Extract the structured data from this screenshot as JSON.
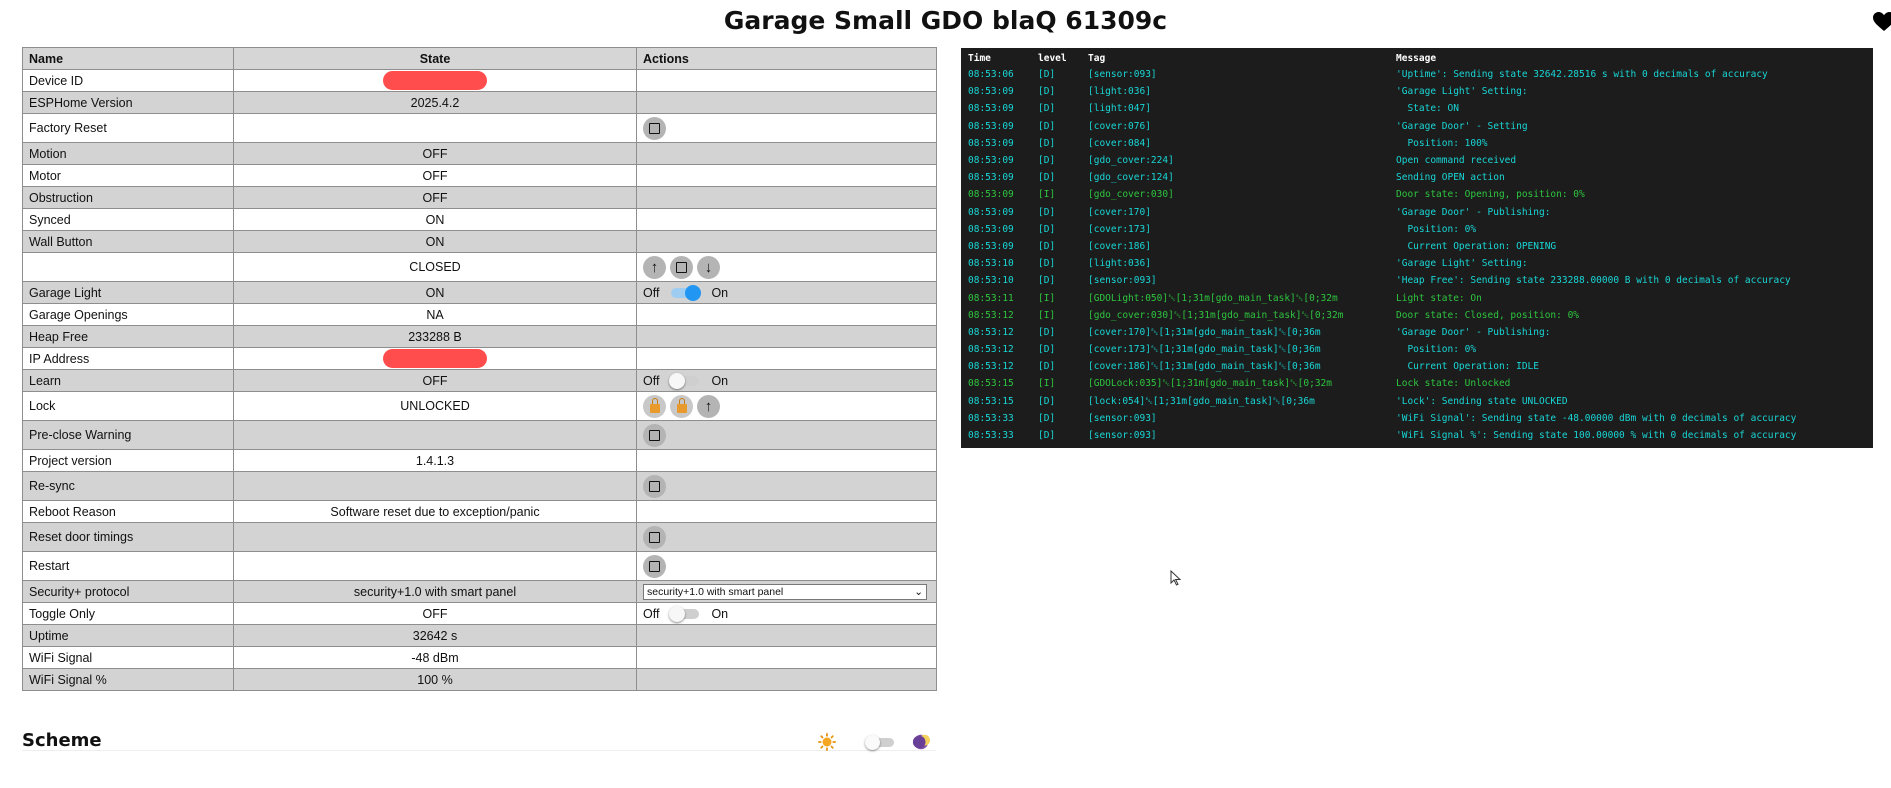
{
  "page": {
    "title": "Garage Small GDO blaQ 61309c",
    "heart_icon": "heart-icon"
  },
  "table": {
    "headers": {
      "name": "Name",
      "state": "State",
      "actions": "Actions"
    },
    "rows": [
      {
        "name": "Device ID",
        "state": "",
        "redacted": true
      },
      {
        "name": "ESPHome Version",
        "state": "2025.4.2"
      },
      {
        "name": "Factory Reset",
        "state": ""
      },
      {
        "name": "Motion",
        "state": "OFF"
      },
      {
        "name": "Motor",
        "state": "OFF"
      },
      {
        "name": "Obstruction",
        "state": "OFF"
      },
      {
        "name": "Synced",
        "state": "ON"
      },
      {
        "name": "Wall Button",
        "state": "ON"
      },
      {
        "name": "",
        "state": "CLOSED"
      },
      {
        "name": "Garage Light",
        "state": "ON",
        "toggle": {
          "off": "Off",
          "on": "On",
          "checked": true
        }
      },
      {
        "name": "Garage Openings",
        "state": "NA"
      },
      {
        "name": "Heap Free",
        "state": "233288 B"
      },
      {
        "name": "IP Address",
        "state": "",
        "redacted": true
      },
      {
        "name": "Learn",
        "state": "OFF",
        "toggle": {
          "off": "Off",
          "on": "On",
          "checked": false
        }
      },
      {
        "name": "Lock",
        "state": "UNLOCKED"
      },
      {
        "name": "Pre-close Warning",
        "state": ""
      },
      {
        "name": "Project version",
        "state": "1.4.1.3"
      },
      {
        "name": "Re-sync",
        "state": ""
      },
      {
        "name": "Reboot Reason",
        "state": "Software reset due to exception/panic"
      },
      {
        "name": "Reset door timings",
        "state": ""
      },
      {
        "name": "Restart",
        "state": ""
      },
      {
        "name": "Security+ protocol",
        "state": "security+1.0 with smart panel",
        "select": "security+1.0 with smart panel"
      },
      {
        "name": "Toggle Only",
        "state": "OFF",
        "toggle": {
          "off": "Off",
          "on": "On",
          "checked": false
        }
      },
      {
        "name": "Uptime",
        "state": "32642 s"
      },
      {
        "name": "WiFi Signal",
        "state": "-48 dBm"
      },
      {
        "name": "WiFi Signal %",
        "state": "100 %"
      }
    ]
  },
  "scheme": {
    "label": "Scheme",
    "light_icon": "sun-icon",
    "dark_icon": "moon-icon",
    "dark_mode": false
  },
  "log": {
    "headers": {
      "time": "Time",
      "level": "level",
      "tag": "Tag",
      "message": "Message"
    },
    "entries": [
      {
        "time": "08:53:06",
        "level": "[D]",
        "tag": "[sensor:093]",
        "message": "'Uptime': Sending state 32642.28516 s with 0 decimals of accuracy"
      },
      {
        "time": "08:53:09",
        "level": "[D]",
        "tag": "[light:036]",
        "message": "'Garage Light' Setting:"
      },
      {
        "time": "08:53:09",
        "level": "[D]",
        "tag": "[light:047]",
        "message": "  State: ON"
      },
      {
        "time": "08:53:09",
        "level": "[D]",
        "tag": "[cover:076]",
        "message": "'Garage Door' - Setting"
      },
      {
        "time": "08:53:09",
        "level": "[D]",
        "tag": "[cover:084]",
        "message": "  Position: 100%"
      },
      {
        "time": "08:53:09",
        "level": "[D]",
        "tag": "[gdo_cover:224]",
        "message": "Open command received"
      },
      {
        "time": "08:53:09",
        "level": "[D]",
        "tag": "[gdo_cover:124]",
        "message": "Sending OPEN action"
      },
      {
        "time": "08:53:09",
        "level": "[I]",
        "tag": "[gdo_cover:030]",
        "message": "Door state: Opening, position: 0%"
      },
      {
        "time": "08:53:09",
        "level": "[D]",
        "tag": "[cover:170]",
        "message": "'Garage Door' - Publishing:"
      },
      {
        "time": "08:53:09",
        "level": "[D]",
        "tag": "[cover:173]",
        "message": "  Position: 0%"
      },
      {
        "time": "08:53:09",
        "level": "[D]",
        "tag": "[cover:186]",
        "message": "  Current Operation: OPENING"
      },
      {
        "time": "08:53:10",
        "level": "[D]",
        "tag": "[light:036]",
        "message": "'Garage Light' Setting:"
      },
      {
        "time": "08:53:10",
        "level": "[D]",
        "tag": "[sensor:093]",
        "message": "'Heap Free': Sending state 233288.00000 B with 0 decimals of accuracy"
      },
      {
        "time": "08:53:11",
        "level": "[I]",
        "tag": "[GDOLight:050]\u001b[1;31m[gdo_main_task]\u001b[0;32m",
        "message": "Light state: On"
      },
      {
        "time": "08:53:12",
        "level": "[I]",
        "tag": "[gdo_cover:030]\u001b[1;31m[gdo_main_task]\u001b[0;32m",
        "message": "Door state: Closed, position: 0%"
      },
      {
        "time": "08:53:12",
        "level": "[D]",
        "tag": "[cover:170]\u001b[1;31m[gdo_main_task]\u001b[0;36m",
        "message": "'Garage Door' - Publishing:"
      },
      {
        "time": "08:53:12",
        "level": "[D]",
        "tag": "[cover:173]\u001b[1;31m[gdo_main_task]\u001b[0;36m",
        "message": "  Position: 0%"
      },
      {
        "time": "08:53:12",
        "level": "[D]",
        "tag": "[cover:186]\u001b[1;31m[gdo_main_task]\u001b[0;36m",
        "message": "  Current Operation: IDLE"
      },
      {
        "time": "08:53:15",
        "level": "[I]",
        "tag": "[GDOLock:035]\u001b[1;31m[gdo_main_task]\u001b[0;32m",
        "message": "Lock state: Unlocked"
      },
      {
        "time": "08:53:15",
        "level": "[D]",
        "tag": "[lock:054]\u001b[1;31m[gdo_main_task]\u001b[0;36m",
        "message": "'Lock': Sending state UNLOCKED"
      },
      {
        "time": "08:53:33",
        "level": "[D]",
        "tag": "[sensor:093]",
        "message": "'WiFi Signal': Sending state -48.00000 dBm with 0 decimals of accuracy"
      },
      {
        "time": "08:53:33",
        "level": "[D]",
        "tag": "[sensor:093]",
        "message": "'WiFi Signal %': Sending state 100.00000 % with 0 decimals of accuracy"
      }
    ]
  }
}
